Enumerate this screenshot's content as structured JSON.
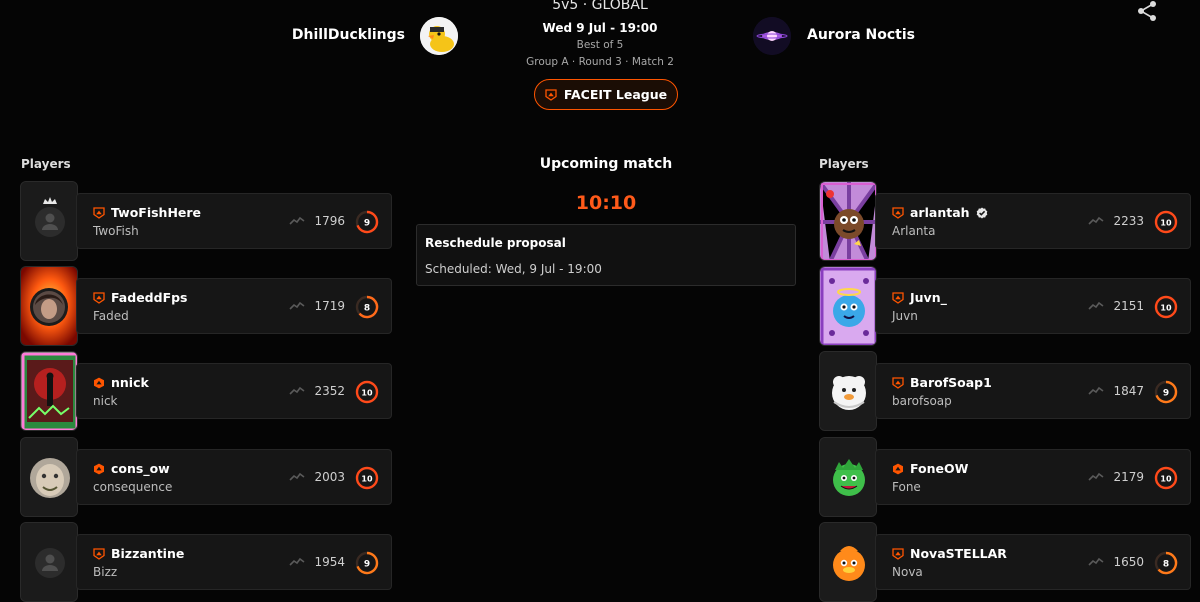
{
  "header": {
    "mode": "5v5 · GLOBAL",
    "date": "Wed 9 Jul - 19:00",
    "best_of": "Best of 5",
    "group_line": "Group A · Round 3 · Match 2",
    "league_button": "FACEIT League"
  },
  "teams": {
    "left": {
      "name": "DhillDucklings"
    },
    "right": {
      "name": "Aurora Noctis"
    }
  },
  "center": {
    "title": "Upcoming match",
    "countdown": "10:10",
    "proposal_title": "Reschedule proposal",
    "proposal_subtitle": "Scheduled: Wed, 9 Jul - 19:00"
  },
  "left_players": {
    "title": "Players",
    "items": [
      {
        "name": "TwoFishHere",
        "nickname": "TwoFish",
        "elo": "1796",
        "level": "9"
      },
      {
        "name": "FadeddFps",
        "nickname": "Faded",
        "elo": "1719",
        "level": "8"
      },
      {
        "name": "nnick",
        "nickname": "nick",
        "elo": "2352",
        "level": "10"
      },
      {
        "name": "cons_ow",
        "nickname": "consequence",
        "elo": "2003",
        "level": "10"
      },
      {
        "name": "Bizzantine",
        "nickname": "Bizz",
        "elo": "1954",
        "level": "9"
      }
    ]
  },
  "right_players": {
    "title": "Players",
    "items": [
      {
        "name": "arlantah",
        "nickname": "Arlanta",
        "elo": "2233",
        "level": "10"
      },
      {
        "name": "Juvn_",
        "nickname": "Juvn",
        "elo": "2151",
        "level": "10"
      },
      {
        "name": "BarofSoap1",
        "nickname": "barofsoap",
        "elo": "1847",
        "level": "9"
      },
      {
        "name": "FoneOW",
        "nickname": "Fone",
        "elo": "2179",
        "level": "10"
      },
      {
        "name": "NovaSTELLAR",
        "nickname": "Nova",
        "elo": "1650",
        "level": "8"
      }
    ]
  },
  "colors": {
    "accent": "#ff5500",
    "level_ring": "#ff4a1a",
    "background": "#050505",
    "card": "#161616"
  },
  "icons": [
    "share-icon",
    "faceit-shield-icon",
    "verified-icon",
    "elo-trend-icon",
    "level-icon"
  ]
}
